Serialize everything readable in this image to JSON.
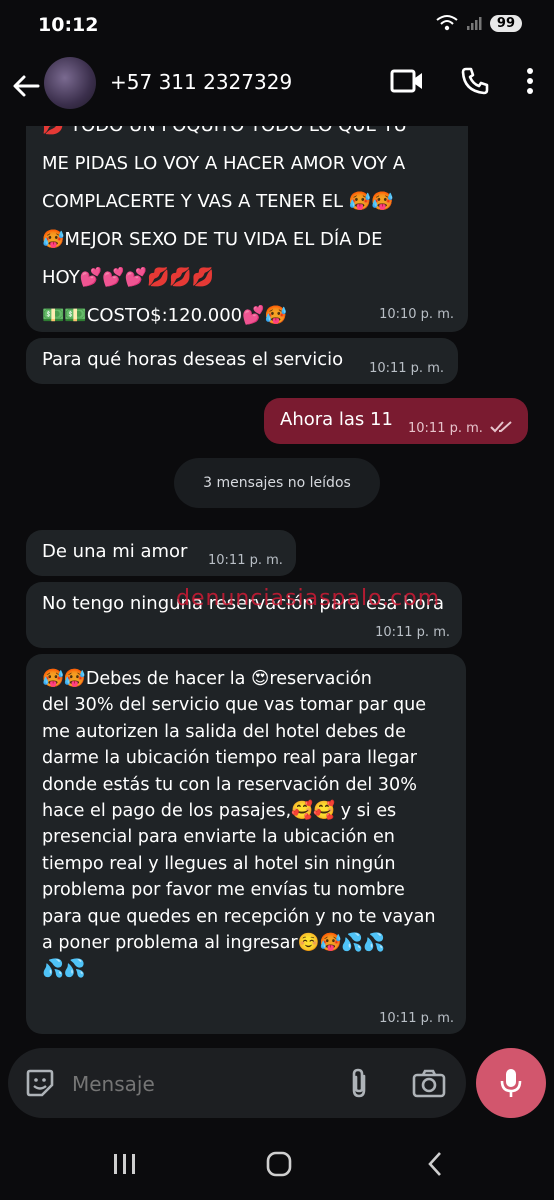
{
  "status": {
    "time": "10:12",
    "battery": "99"
  },
  "header": {
    "contact": "+57 311 2327329"
  },
  "messages": {
    "m1": {
      "line1": "💋 TODO UN POQUITO TODO LO QUE TU",
      "line2": "ME PIDAS LO VOY A HACER AMOR VOY A",
      "line3": "COMPLACERTE Y VAS A TENER EL 🥵🥵",
      "line4": "🥵MEJOR SEXO DE TU VIDA EL DÍA DE",
      "line5": "HOY💕💕💕💋💋💋",
      "line6": "💵💵COSTO$:120.000💕🥵",
      "time": "10:10 p. m."
    },
    "m2": {
      "text": "Para qué horas deseas el servicio",
      "time": "10:11 p. m."
    },
    "m3": {
      "text": "Ahora las 11",
      "time": "10:11 p. m."
    },
    "unread": "3 mensajes no leídos",
    "m4": {
      "text": "De una mi amor",
      "time": "10:11 p. m."
    },
    "m5": {
      "text": "No tengo ninguna reservación para esa hora",
      "time": "10:11 p. m."
    },
    "m6": {
      "lines": [
        "🥵🥵Debes de hacer la 😍reservación",
        "del 30% del servicio que vas tomar par que",
        "me autorizen la salida del hotel debes de",
        "darme la ubicación tiempo real para llegar",
        "donde estás tu con la reservación del 30%",
        "hace el pago de los pasajes,🥰🥰 y si es",
        "presencial para enviarte la ubicación en",
        "tiempo real y llegues al hotel sin ningún",
        "problema por favor me envías tu nombre",
        "para que quedes en recepción y no te vayan",
        "a poner problema al ingresar☺️🥵💦💦",
        "💦💦"
      ],
      "time": "10:11 p. m."
    }
  },
  "watermark": "denunciasiaspalo.com",
  "composer": {
    "placeholder": "Mensaje"
  },
  "icons": {
    "back": "arrow-left-icon",
    "video": "video-icon",
    "call": "phone-icon",
    "menu": "more-vertical-icon",
    "sticker": "sticker-icon",
    "attach": "attach-icon",
    "camera": "camera-icon",
    "mic": "mic-icon"
  },
  "colors": {
    "incoming": "#1f2326",
    "outgoing": "#7a1b30",
    "mic": "#d2566d"
  }
}
